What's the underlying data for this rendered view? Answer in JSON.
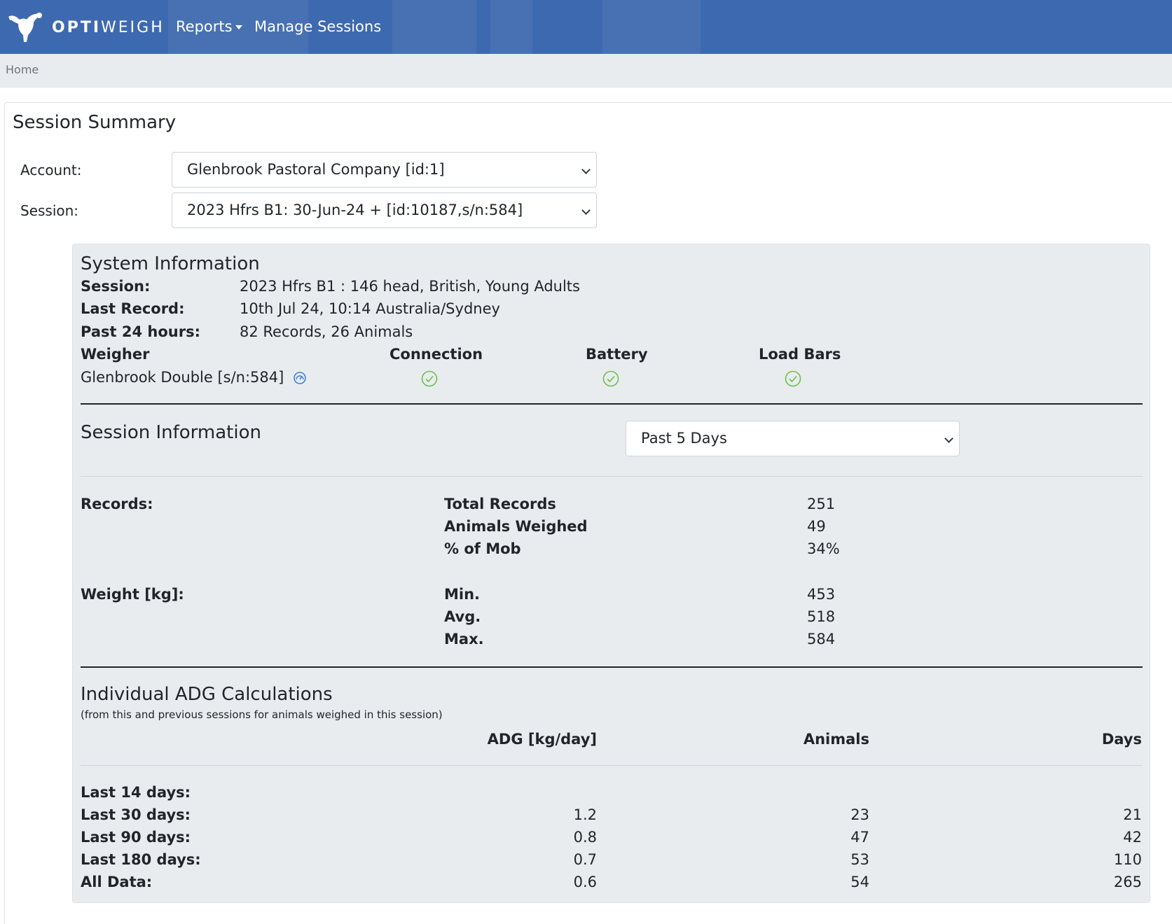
{
  "navbar": {
    "brand_bold": "OPTI",
    "brand_light": "WEIGH",
    "reports": "Reports",
    "manage_sessions": "Manage Sessions"
  },
  "breadcrumb": {
    "home": "Home"
  },
  "page_title": "Session Summary",
  "account": {
    "label": "Account:",
    "value": "Glenbrook Pastoral Company [id:1]"
  },
  "session": {
    "label": "Session:",
    "value": "2023 Hfrs B1: 30-Jun-24 + [id:10187,s/n:584]"
  },
  "system_info": {
    "title": "System Information",
    "session_label": "Session:",
    "session_value": "2023 Hfrs B1 : 146 head, British, Young Adults",
    "last_record_label": "Last Record:",
    "last_record_value": "10th Jul 24, 10:14 Australia/Sydney",
    "past24_label": "Past 24 hours:",
    "past24_value": "82 Records, 26 Animals",
    "weigher_header": "Weigher",
    "connection_header": "Connection",
    "battery_header": "Battery",
    "loadbars_header": "Load Bars",
    "weigher_value": "Glenbrook Double [s/n:584]",
    "status_color": "#6cc04a"
  },
  "session_info": {
    "title": "Session Information",
    "period": "Past 5 Days",
    "records_label": "Records:",
    "total_records_label": "Total Records",
    "total_records": "251",
    "animals_weighed_label": "Animals Weighed",
    "animals_weighed": "49",
    "pct_mob_label": "% of Mob",
    "pct_mob": "34%",
    "weight_label": "Weight [kg]:",
    "min_label": "Min.",
    "min": "453",
    "avg_label": "Avg.",
    "avg": "518",
    "max_label": "Max.",
    "max": "584"
  },
  "adg": {
    "title": "Individual ADG Calculations",
    "note": "(from this and previous sessions for animals weighed in this session)",
    "col_adg": "ADG [kg/day]",
    "col_animals": "Animals",
    "col_days": "Days",
    "rows": [
      {
        "label": "Last 14 days:",
        "adg": "",
        "animals": "",
        "days": ""
      },
      {
        "label": "Last 30 days:",
        "adg": "1.2",
        "animals": "23",
        "days": "21"
      },
      {
        "label": "Last 90 days:",
        "adg": "0.8",
        "animals": "47",
        "days": "42"
      },
      {
        "label": "Last 180 days:",
        "adg": "0.7",
        "animals": "53",
        "days": "110"
      },
      {
        "label": "All Data:",
        "adg": "0.6",
        "animals": "54",
        "days": "265"
      }
    ]
  }
}
